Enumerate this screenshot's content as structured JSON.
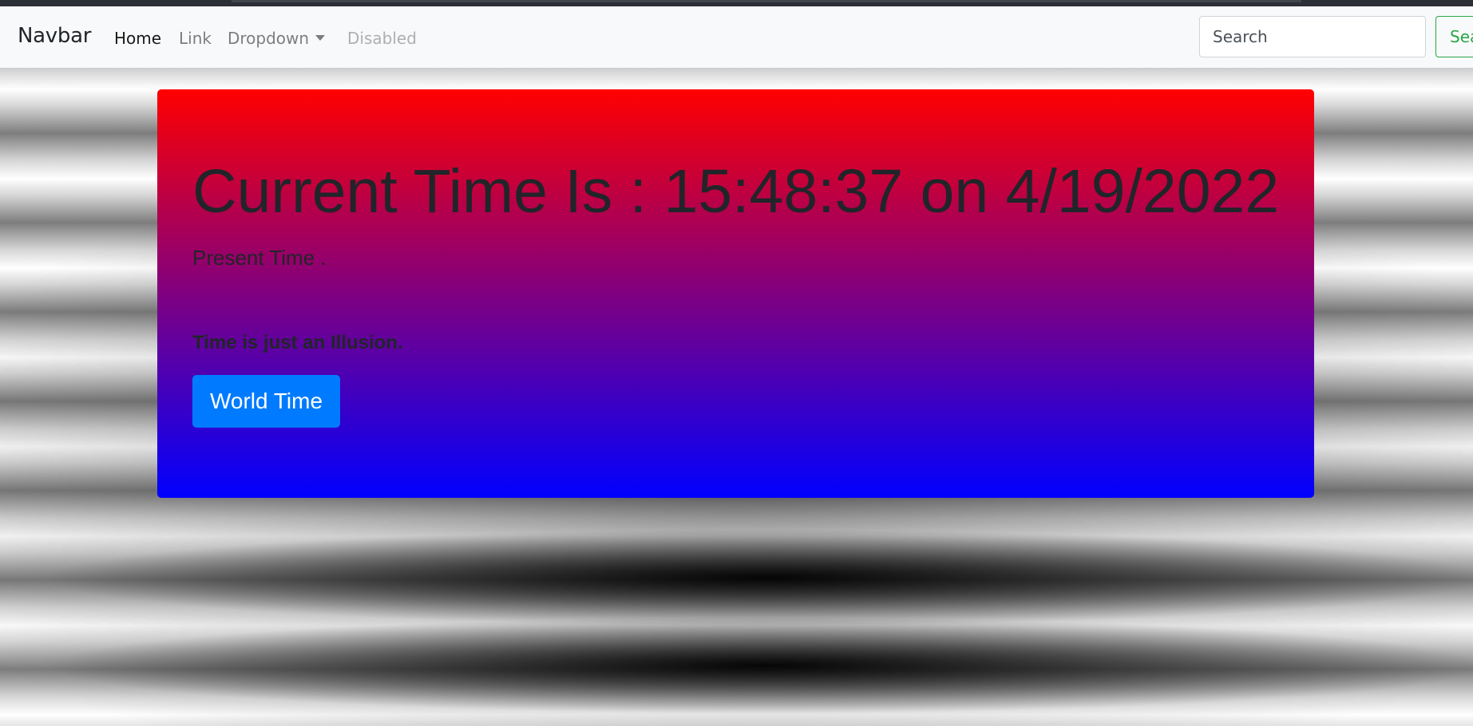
{
  "navbar": {
    "brand": "Navbar",
    "items": [
      {
        "label": "Home",
        "state": "active"
      },
      {
        "label": "Link",
        "state": "normal"
      },
      {
        "label": "Dropdown",
        "state": "normal",
        "has_dropdown": true
      },
      {
        "label": "Disabled",
        "state": "disabled"
      }
    ],
    "search": {
      "placeholder": "Search",
      "button_label": "Search"
    }
  },
  "jumbotron": {
    "title": "Current Time Is : 15:48:37 on 4/19/2022",
    "lead": "Present Time .",
    "quote": "Time is just an Illusion.",
    "button_label": "World Time"
  },
  "colors": {
    "navbar_bg": "#f8f9fa",
    "gradient_top": "#ff0000",
    "gradient_mid": "#800080",
    "gradient_bottom": "#0000ff",
    "primary": "#007bff",
    "success": "#28a745"
  }
}
